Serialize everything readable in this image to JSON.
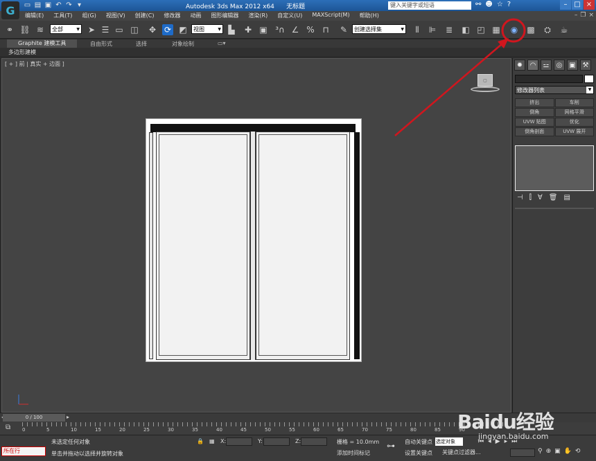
{
  "titlebar": {
    "app_title": "Autodesk 3ds Max  2012 x64",
    "file_title": "无标题",
    "search_placeholder": "键入关键字或短语",
    "logo_glyph": "G"
  },
  "menu": [
    "编辑(E)",
    "工具(T)",
    "组(G)",
    "视图(V)",
    "创建(C)",
    "修改器",
    "动画",
    "图形编辑器",
    "渲染(R)",
    "自定义(U)",
    "MAXScript(M)",
    "帮助(H)"
  ],
  "toolbar": {
    "filter_dropdown": "全部",
    "ref_coord_dropdown": "视图",
    "selection_set_dropdown": "创建选择集",
    "highlighted_tool": "render-setup"
  },
  "ribbon": {
    "tabs": [
      "Graphite 建模工具",
      "自由形式",
      "选择",
      "对象绘制"
    ],
    "subtitle": "多边形建模"
  },
  "viewport": {
    "label": "[ + ] 前 | 真实 + 边面 ]"
  },
  "command_panel": {
    "modifier_list": "修改器列表",
    "modifier_buttons": [
      "挤出",
      "车削",
      "倒角",
      "网格平滑",
      "UVW 贴图",
      "优化",
      "倒角剖面",
      "UVW 展开"
    ]
  },
  "timeline": {
    "frame_range": "0 / 100",
    "ticks": [
      "0",
      "5",
      "10",
      "15",
      "20",
      "25",
      "30",
      "35",
      "40",
      "45",
      "50",
      "55",
      "60",
      "65",
      "70",
      "75",
      "80",
      "85",
      "90"
    ]
  },
  "status": {
    "running_label": "所在行",
    "line1": "未选定任何对象",
    "line2": "单击并拖动以选择并旋转对象",
    "x_label": "X:",
    "y_label": "Y:",
    "z_label": "Z:",
    "grid": "栅格 = 10.0mm",
    "add_time_tag": "添加时间标记",
    "auto_key": "自动关键点",
    "set_key": "设置关键点",
    "selected_dropdown": "选定对象",
    "key_filters": "关键点过滤器..."
  },
  "watermark": {
    "brand": "Baidu经验",
    "url": "jingyan.baidu.com"
  },
  "colors": {
    "annotation_red": "#d0161e",
    "title_blue": "#1d5596",
    "viewport_bg": "#444444"
  }
}
